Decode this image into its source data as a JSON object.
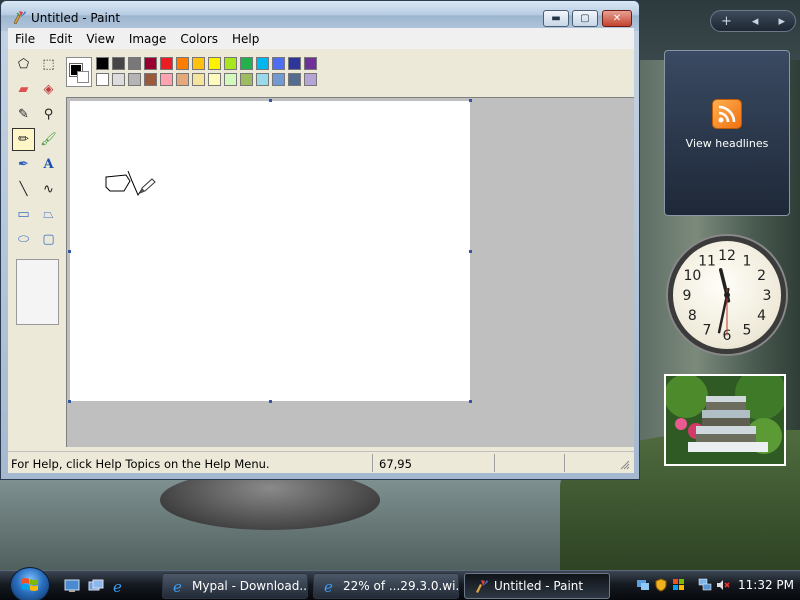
{
  "window": {
    "title": "Untitled - Paint",
    "controls": {
      "minimize": "▬",
      "maximize": "▢",
      "close": "✕"
    }
  },
  "menu": [
    "File",
    "Edit",
    "View",
    "Image",
    "Colors",
    "Help"
  ],
  "tools": [
    {
      "name": "free-form-select-tool-icon",
      "glyph": "⬠"
    },
    {
      "name": "rect-select-tool-icon",
      "glyph": "⬚"
    },
    {
      "name": "eraser-tool-icon",
      "glyph": "▰"
    },
    {
      "name": "fill-tool-icon",
      "glyph": "◈"
    },
    {
      "name": "color-picker-tool-icon",
      "glyph": "✎"
    },
    {
      "name": "magnifier-tool-icon",
      "glyph": "⚲"
    },
    {
      "name": "pencil-tool-icon",
      "glyph": "✏"
    },
    {
      "name": "brush-tool-icon",
      "glyph": "🖌"
    },
    {
      "name": "airbrush-tool-icon",
      "glyph": "✒"
    },
    {
      "name": "text-tool-icon",
      "glyph": "A"
    },
    {
      "name": "line-tool-icon",
      "glyph": "╲"
    },
    {
      "name": "curve-tool-icon",
      "glyph": "∿"
    },
    {
      "name": "rectangle-tool-icon",
      "glyph": "▭"
    },
    {
      "name": "polygon-tool-icon",
      "glyph": "⏢"
    },
    {
      "name": "ellipse-tool-icon",
      "glyph": "⬭"
    },
    {
      "name": "rounded-rect-tool-icon",
      "glyph": "▢"
    }
  ],
  "active_tool": 6,
  "palette": {
    "foreground": "#000000",
    "background": "#ffffff",
    "top_row": [
      "#000000",
      "#464646",
      "#787878",
      "#990030",
      "#ed1c24",
      "#ff7e00",
      "#ffc20e",
      "#fff200",
      "#a8e61d",
      "#22b14c",
      "#00b7ef",
      "#4d6df3",
      "#2f3699",
      "#6f3198"
    ],
    "bottom_row": [
      "#ffffff",
      "#dcdcdc",
      "#b4b4b4",
      "#9c5a3c",
      "#ffa3b1",
      "#e5aa7a",
      "#f5e49c",
      "#fff9bd",
      "#d3f9bc",
      "#9dbb61",
      "#99d9ea",
      "#709ad1",
      "#546d8e",
      "#b5a5d5"
    ]
  },
  "status": {
    "help": "For Help, click Help Topics on the Help Menu.",
    "coords": "67,95"
  },
  "sidebar": {
    "controls": {
      "add": "+",
      "prev": "◂",
      "next": "▸"
    },
    "rss": {
      "icon": "rss-icon",
      "glyph": "))",
      "label": "View headlines"
    },
    "clock": {
      "hour": 11,
      "minute": 32,
      "second": 30,
      "numbers": [
        "12",
        "1",
        "2",
        "3",
        "4",
        "5",
        "6",
        "7",
        "8",
        "9",
        "10",
        "11"
      ]
    }
  },
  "taskbar": {
    "tasks": [
      {
        "label": "Mypal - Download...",
        "icon": "browser-icon"
      },
      {
        "label": "22% of ...29.3.0.wi...",
        "icon": "browser-icon"
      },
      {
        "label": "Untitled - Paint",
        "icon": "paint-icon"
      }
    ],
    "active_task": 2,
    "time": "11:32 PM"
  },
  "colors": {
    "accent": "#2a6fc0",
    "close_btn": "#c2432f",
    "rss_orange": "#f07010"
  }
}
